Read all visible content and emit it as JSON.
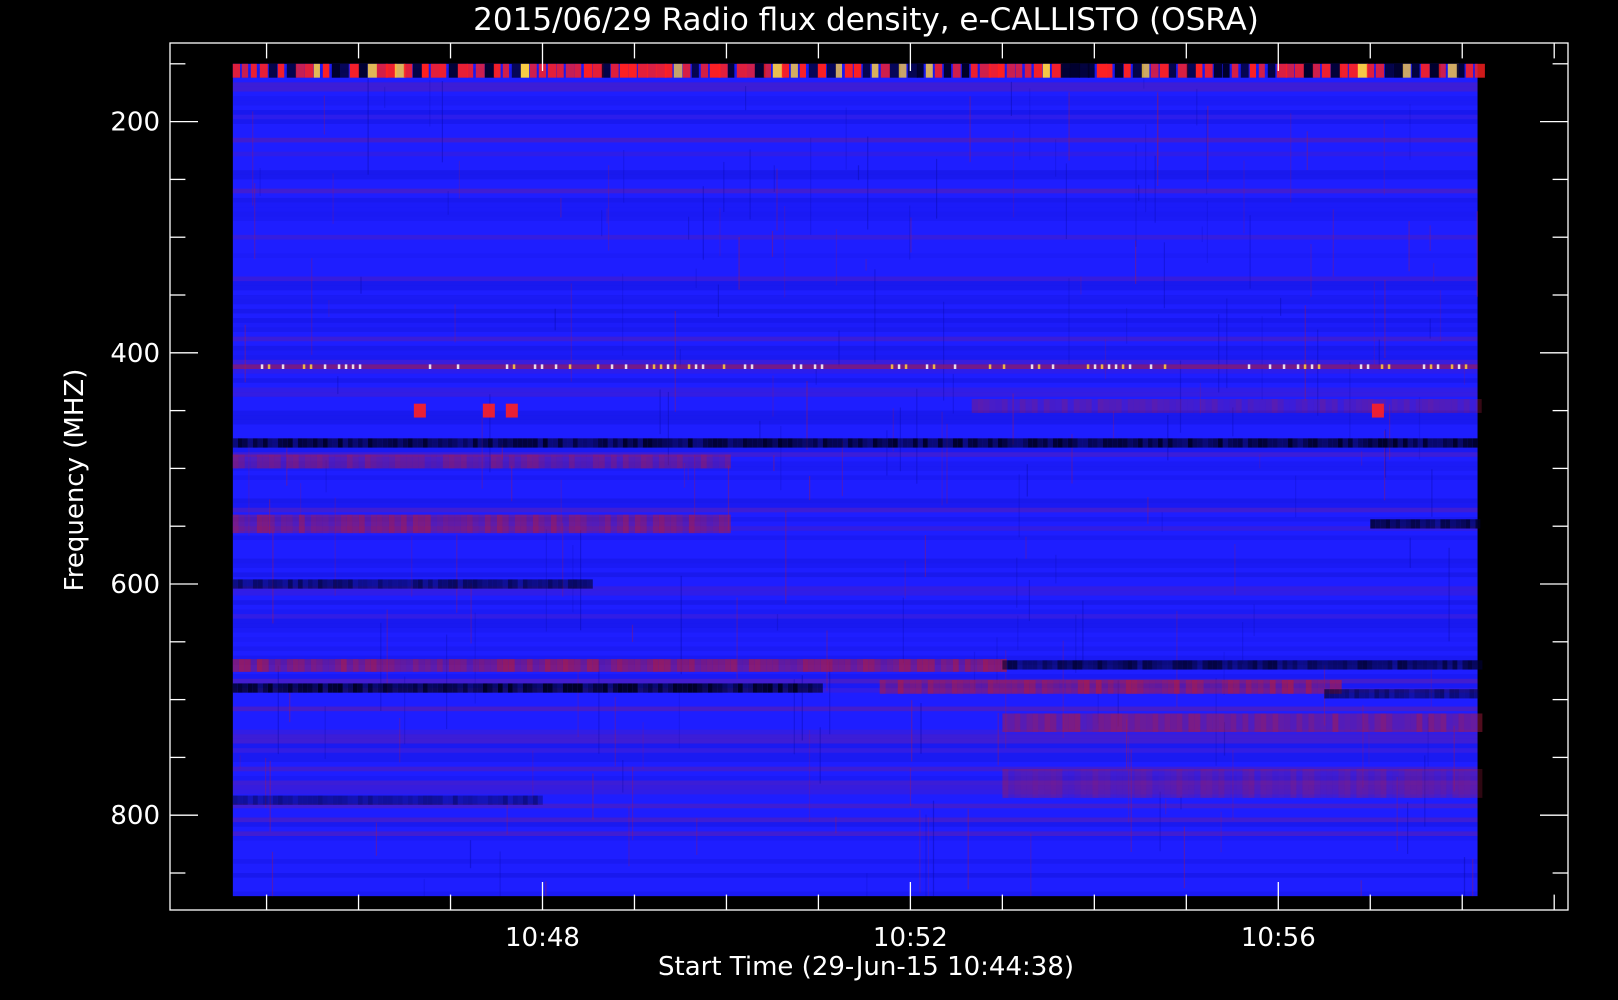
{
  "chart_data": {
    "type": "heatmap",
    "title": "2015/06/29  Radio flux density, e-CALLISTO (OSRA)",
    "xlabel": "Start Time (29-Jun-15 10:44:38)",
    "ylabel": "Frequency (MHZ)",
    "x_range": [
      "10:44:38",
      "10:58:10"
    ],
    "y_range_mhz": [
      150,
      870
    ],
    "y_inverted": true,
    "x_axis_limits": [
      "10:43:57",
      "10:59:09"
    ],
    "y_axis_limits_mhz": [
      132,
      882
    ],
    "x_ticks": [
      {
        "value": "10:48",
        "label": "10:48"
      },
      {
        "value": "10:52",
        "label": "10:52"
      },
      {
        "value": "10:56",
        "label": "10:56"
      }
    ],
    "x_minor_ticks": [
      "10:45",
      "10:46",
      "10:47",
      "10:49",
      "10:50",
      "10:51",
      "10:53",
      "10:54",
      "10:55",
      "10:57",
      "10:58",
      "10:59"
    ],
    "y_ticks": [
      {
        "value": 200,
        "label": "200"
      },
      {
        "value": 400,
        "label": "400"
      },
      {
        "value": 600,
        "label": "600"
      },
      {
        "value": 800,
        "label": "800"
      }
    ],
    "y_minor_ticks": [
      150,
      250,
      300,
      350,
      450,
      500,
      550,
      650,
      700,
      750,
      850
    ],
    "colors": {
      "background": "#000000",
      "axes": "#ffffff",
      "base": "#1e1eff",
      "dark": "#000028",
      "red": "#b01a40",
      "bright": "#ff2020",
      "yellow": "#ffd040"
    },
    "colormap": [
      "#000000",
      "#1e1eff",
      "#9c1d57",
      "#ff1010",
      "#ffe040"
    ],
    "features": {
      "top_flicker_band_mhz": [
        150,
        162
      ],
      "interference_line_mhz": 412,
      "dark_lines": [
        {
          "mhz": 478,
          "from": "10:44:38",
          "to": "10:58:10",
          "strength": 0.9
        },
        {
          "mhz": 548,
          "from": "10:57:00",
          "to": "10:58:10",
          "strength": 0.8
        },
        {
          "mhz": 600,
          "from": "10:44:38",
          "to": "10:48:30",
          "strength": 0.7
        },
        {
          "mhz": 670,
          "from": "10:53:00",
          "to": "10:58:10",
          "strength": 0.8
        },
        {
          "mhz": 690,
          "from": "10:44:38",
          "to": "10:51:00",
          "strength": 0.95
        },
        {
          "mhz": 695,
          "from": "10:56:30",
          "to": "10:58:10",
          "strength": 0.6
        },
        {
          "mhz": 787,
          "from": "10:44:38",
          "to": "10:48:00",
          "strength": 0.5
        }
      ],
      "red_bands": [
        {
          "mhz_from": 488,
          "mhz_to": 500,
          "from": "10:44:38",
          "to": "10:50:00",
          "strength": 0.5
        },
        {
          "mhz_from": 540,
          "mhz_to": 556,
          "from": "10:44:38",
          "to": "10:50:00",
          "strength": 0.6
        },
        {
          "mhz_from": 665,
          "mhz_to": 676,
          "from": "10:44:38",
          "to": "10:53:00",
          "strength": 0.7
        },
        {
          "mhz_from": 683,
          "mhz_to": 695,
          "from": "10:51:40",
          "to": "10:56:40",
          "strength": 0.7
        },
        {
          "mhz_from": 712,
          "mhz_to": 728,
          "from": "10:53:00",
          "to": "10:58:10",
          "strength": 0.6
        },
        {
          "mhz_from": 440,
          "mhz_to": 452,
          "from": "10:52:40",
          "to": "10:58:10",
          "strength": 0.35
        },
        {
          "mhz_from": 760,
          "mhz_to": 785,
          "from": "10:53:00",
          "to": "10:58:10",
          "strength": 0.35
        }
      ],
      "burst_spots": [
        {
          "time": "10:46:40",
          "mhz": 450
        },
        {
          "time": "10:47:25",
          "mhz": 450
        },
        {
          "time": "10:47:40",
          "mhz": 450
        },
        {
          "time": "10:57:05",
          "mhz": 450
        }
      ]
    }
  }
}
